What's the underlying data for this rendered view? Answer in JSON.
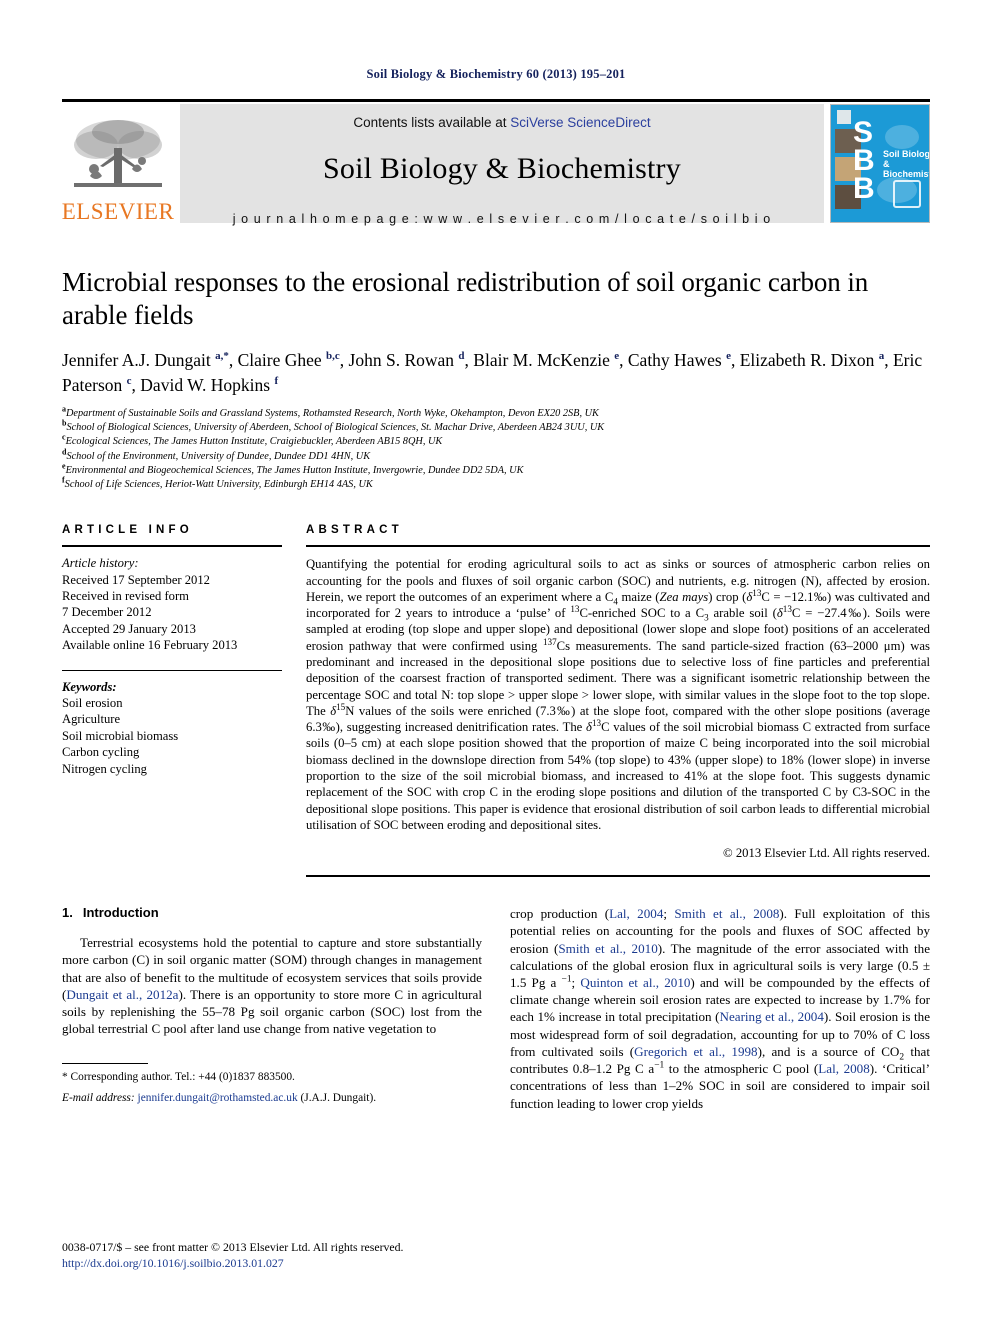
{
  "running_head": "Soil Biology & Biochemistry 60 (2013) 195–201",
  "masthead": {
    "publisher_name": "ELSEVIER",
    "contents_prefix": "Contents lists available at ",
    "contents_link": "SciVerse ScienceDirect",
    "journal_title": "Soil Biology & Biochemistry",
    "homepage": "j o u r n a l   h o m e p a g e :   w w w . e l s e v i e r . c o m / l o c a t e / s o i l b i o",
    "cover": {
      "letters": "S\nB\nB",
      "caption_line1": "Soil Biology &",
      "caption_line2": "Biochemistry",
      "bg_color": "#1c9ad6"
    }
  },
  "article": {
    "title": "Microbial responses to the erosional redistribution of soil organic carbon in arable fields",
    "authors_html": "Jennifer A.J. Dungait <sup>a,*</sup>, Claire Ghee <sup>b,c</sup>, John S. Rowan <sup>d</sup>, Blair M. McKenzie <sup>e</sup>, Cathy Hawes <sup>e</sup>, Elizabeth R. Dixon <sup>a</sup>, Eric Paterson <sup>c</sup>, David W. Hopkins <sup>f</sup>",
    "affiliations": [
      {
        "mark": "a",
        "text": "Department of Sustainable Soils and Grassland Systems, Rothamsted Research, North Wyke, Okehampton, Devon EX20 2SB, UK"
      },
      {
        "mark": "b",
        "text": "School of Biological Sciences, University of Aberdeen, School of Biological Sciences, St. Machar Drive, Aberdeen AB24 3UU, UK"
      },
      {
        "mark": "c",
        "text": "Ecological Sciences, The James Hutton Institute, Craigiebuckler, Aberdeen AB15 8QH, UK"
      },
      {
        "mark": "d",
        "text": "School of the Environment, University of Dundee, Dundee DD1 4HN, UK"
      },
      {
        "mark": "e",
        "text": "Environmental and Biogeochemical Sciences, The James Hutton Institute, Invergowrie, Dundee DD2 5DA, UK"
      },
      {
        "mark": "f",
        "text": "School of Life Sciences, Heriot-Watt University, Edinburgh EH14 4AS, UK"
      }
    ]
  },
  "article_info": {
    "heading": "ARTICLE INFO",
    "history_label": "Article history:",
    "history": [
      "Received 17 September 2012",
      "Received in revised form",
      "7 December 2012",
      "Accepted 29 January 2013",
      "Available online 16 February 2013"
    ],
    "keywords_label": "Keywords:",
    "keywords": [
      "Soil erosion",
      "Agriculture",
      "Soil microbial biomass",
      "Carbon cycling",
      "Nitrogen cycling"
    ]
  },
  "abstract": {
    "heading": "ABSTRACT",
    "text_html": "Quantifying the potential for eroding agricultural soils to act as sinks or sources of atmospheric carbon relies on accounting for the pools and fluxes of soil organic carbon (SOC) and nutrients, e.g. nitrogen (N), affected by erosion. Herein, we report the outcomes of an experiment where a C<sub>4</sub> maize (<span class=\"ital\">Zea mays</span>) crop (<span class=\"ital\">&#948;</span><sup>13</sup>C = &#8722;12.1&#8240;) was cultivated and incorporated for 2 years to introduce a &#8216;pulse&#8217; of <sup>13</sup>C-enriched SOC to a C<sub>3</sub> arable soil (<span class=\"ital\">&#948;</span><sup>13</sup>C = &#8722;27.4&#8240;). Soils were sampled at eroding (top slope and upper slope) and depositional (lower slope and slope foot) positions of an accelerated erosion pathway that were confirmed using <sup>137</sup>Cs measurements. The sand particle-sized fraction (63&#8211;2000 &#956;m) was predominant and increased in the depositional slope positions due to selective loss of fine particles and preferential deposition of the coarsest fraction of transported sediment. There was a significant isometric relationship between the percentage SOC and total N: top slope &gt; upper slope &gt; lower slope, with similar values in the slope foot to the top slope. The <span class=\"ital\">&#948;</span><sup>15</sup>N values of the soils were enriched (7.3&#8240;) at the slope foot, compared with the other slope positions (average 6.3&#8240;), suggesting increased denitrification rates. The <span class=\"ital\">&#948;</span><sup>13</sup>C values of the soil microbial biomass C extracted from surface soils (0&#8211;5 cm) at each slope position showed that the proportion of maize C being incorporated into the soil microbial biomass declined in the downslope direction from 54% (top slope) to 43% (upper slope) to 18% (lower slope) in inverse proportion to the size of the soil microbial biomass, and increased to 41% at the slope foot. This suggests dynamic replacement of the SOC with crop C in the eroding slope positions and dilution of the transported C by C3-SOC in the depositional slope positions. This paper is evidence that erosional distribution of soil carbon leads to differential microbial utilisation of SOC between eroding and depositional sites.",
    "copyright": "© 2013 Elsevier Ltd. All rights reserved."
  },
  "introduction": {
    "number": "1.",
    "heading": "Introduction",
    "left_para_html": "Terrestrial ecosystems hold the potential to capture and store substantially more carbon (C) in soil organic matter (SOM) through changes in management that are also of benefit to the multitude of ecosystem services that soils provide (<span class=\"ref\">Dungait et al., 2012a</span>). There is an opportunity to store more C in agricultural soils by replenishing the 55&#8211;78 Pg soil organic carbon (SOC) lost from the global terrestrial C pool after land use change from native vegetation to",
    "right_para_html": "crop production (<span class=\"ref\">Lal, 2004</span>; <span class=\"ref\">Smith et al., 2008</span>). Full exploitation of this potential relies on accounting for the pools and fluxes of SOC affected by erosion (<span class=\"ref\">Smith et al., 2010</span>). The magnitude of the error associated with the calculations of the global erosion flux in agricultural soils is very large (0.5 &#177; 1.5 Pg a <sup>&#8722;1</sup>; <span class=\"ref\">Quinton et al., 2010</span>) and will be compounded by the effects of climate change wherein soil erosion rates are expected to increase by 1.7% for each 1% increase in total precipitation (<span class=\"ref\">Nearing et al., 2004</span>). Soil erosion is the most widespread form of soil degradation, accounting for up to 70% of C loss from cultivated soils (<span class=\"ref\">Gregorich et al., 1998</span>), and is a source of CO<sub>2</sub> that contributes 0.8&#8211;1.2 Pg C a<sup>&#8722;1</sup> to the atmospheric C pool (<span class=\"ref\">Lal, 2008</span>). &#8216;Critical&#8217; concentrations of less than 1&#8211;2% SOC in soil are considered to impair soil function leading to lower crop yields"
  },
  "footnotes": {
    "corresponding_html": "* Corresponding author. Tel.: +44 (0)1837 883500.",
    "email_html": "<i>E-mail address:</i> <span class=\"link\">jennifer.dungait@rothamsted.ac.uk</span> (J.A.J. Dungait)."
  },
  "issn": {
    "line1": "0038-0717/$ – see front matter © 2013 Elsevier Ltd. All rights reserved.",
    "doi": "http://dx.doi.org/10.1016/j.soilbio.2013.01.027"
  }
}
